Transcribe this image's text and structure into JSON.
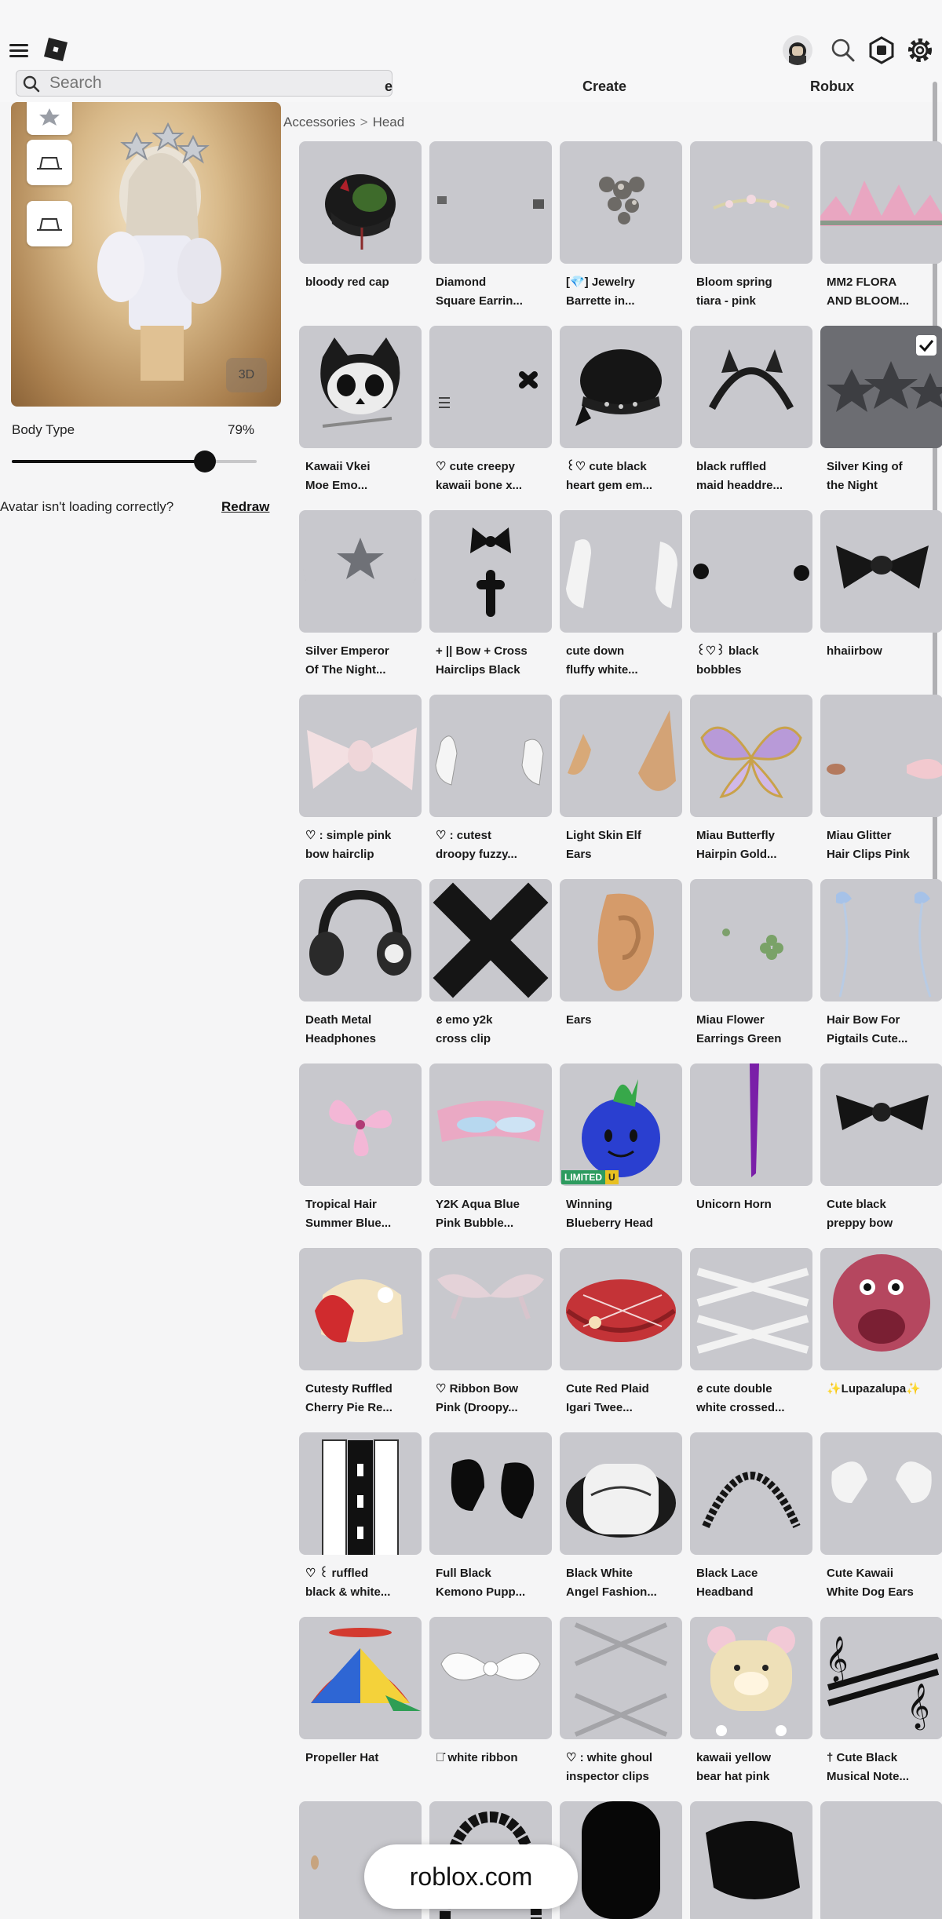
{
  "header": {
    "search_placeholder": "Search",
    "nav": [
      "e",
      "Create",
      "Robux"
    ]
  },
  "preview": {
    "btn_3d": "3D"
  },
  "body_type": {
    "label": "Body Type",
    "value_label": "79%",
    "value": 0.79
  },
  "redraw": {
    "text": "Avatar isn't loading correctly?",
    "link": "Redraw"
  },
  "breadcrumb": {
    "parent": "Accessories",
    "separator": ">",
    "current": "Head"
  },
  "items": [
    {
      "name": "bloody red cap",
      "icon": "cap-icon"
    },
    {
      "name": "Diamond\nSquare Earrin...",
      "icon": "earring-icon"
    },
    {
      "name": "[💎] Jewelry\nBarrette in...",
      "icon": "barrette-icon"
    },
    {
      "name": "Bloom spring\ntiara - pink",
      "icon": "tiara-icon"
    },
    {
      "name": "MM2 FLORA\nAND BLOOM...",
      "icon": "crown-icon"
    },
    {
      "name": "Kawaii Vkei\nMoe Emo...",
      "icon": "cat-skull-icon"
    },
    {
      "name": "♡ cute creepy\nkawaii bone x...",
      "icon": "bone-clip-icon"
    },
    {
      "name": "꒰♡ cute black\nheart gem em...",
      "icon": "black-hat-icon"
    },
    {
      "name": "black ruffled\nmaid headdre...",
      "icon": "headband-icon"
    },
    {
      "name": "Silver King of\nthe Night",
      "icon": "star-crown-icon",
      "selected": true
    },
    {
      "name": "Silver Emperor\nOf The Night...",
      "icon": "star-moon-icon"
    },
    {
      "name": "+ || Bow + Cross\nHairclips Black",
      "icon": "bow-cross-icon"
    },
    {
      "name": "cute down\nfluffy white...",
      "icon": "fluffy-ears-icon"
    },
    {
      "name": "꒰♡꒱ black\nbobbles",
      "icon": "bobbles-icon"
    },
    {
      "name": "hhaiirbow",
      "icon": "black-bow-icon"
    },
    {
      "name": "♡ : simple pink\nbow hairclip",
      "icon": "pink-bow-icon"
    },
    {
      "name": "♡ : cutest\ndroopy fuzzy...",
      "icon": "droopy-ears-icon"
    },
    {
      "name": "Light Skin Elf\nEars",
      "icon": "elf-ears-icon"
    },
    {
      "name": "Miau Butterfly\nHairpin Gold...",
      "icon": "butterfly-icon"
    },
    {
      "name": "Miau Glitter\nHair Clips Pink",
      "icon": "hair-clip-icon"
    },
    {
      "name": "Death Metal\nHeadphones",
      "icon": "headphones-icon"
    },
    {
      "name": "ꫀ emo y2k\ncross clip",
      "icon": "cross-clip-icon"
    },
    {
      "name": "Ears",
      "icon": "ear-icon"
    },
    {
      "name": "Miau Flower\nEarrings Green",
      "icon": "flower-earring-icon"
    },
    {
      "name": "Hair Bow For\nPigtails Cute...",
      "icon": "ribbon-icon"
    },
    {
      "name": "Tropical Hair\nSummer Blue...",
      "icon": "hibiscus-icon"
    },
    {
      "name": "Y2K Aqua Blue\nPink Bubble...",
      "icon": "visor-icon"
    },
    {
      "name": "Winning\nBlueberry Head",
      "icon": "blueberry-icon",
      "badge": [
        "LIMITED",
        "U"
      ]
    },
    {
      "name": "Unicorn Horn",
      "icon": "horn-icon"
    },
    {
      "name": "Cute black\npreppy bow",
      "icon": "preppy-bow-icon"
    },
    {
      "name": "Cutesty Ruffled\nCherry Pie Re...",
      "icon": "cherry-bonnet-icon"
    },
    {
      "name": "♡ Ribbon Bow\nPink (Droopy...",
      "icon": "droopy-bow-icon"
    },
    {
      "name": "Cute Red Plaid\nIgari Twee...",
      "icon": "beret-icon"
    },
    {
      "name": "ꫀ cute double\nwhite crossed...",
      "icon": "crossed-clips-icon"
    },
    {
      "name": "✨Lupazalupa✨",
      "icon": "lips-face-icon"
    },
    {
      "name": "♡ ꒰ ruffled\nblack & white...",
      "icon": "ruffle-icon"
    },
    {
      "name": "Full Black\nKemono Pupp...",
      "icon": "puppy-ears-icon"
    },
    {
      "name": "Black White\nAngel Fashion...",
      "icon": "fur-hat-icon"
    },
    {
      "name": "Black Lace\nHeadband",
      "icon": "lace-headband-icon"
    },
    {
      "name": "Cute Kawaii\nWhite Dog Ears",
      "icon": "dog-ears-icon"
    },
    {
      "name": "Propeller Hat",
      "icon": "propeller-hat-icon"
    },
    {
      "name": "๑̇ white ribbon",
      "icon": "white-ribbon-icon"
    },
    {
      "name": "♡ : white ghoul\ninspector clips",
      "icon": "ghoul-clips-icon"
    },
    {
      "name": "kawaii yellow\nbear hat pink",
      "icon": "bear-hat-icon"
    },
    {
      "name": "† Cute Black\nMusical Note...",
      "icon": "music-note-icon"
    },
    {
      "name": "",
      "icon": "small-item-icon"
    },
    {
      "name": "",
      "icon": "braid-icon"
    },
    {
      "name": "",
      "icon": "black-head-icon"
    },
    {
      "name": "",
      "icon": "black-cap-icon"
    },
    {
      "name": "",
      "icon": "empty-icon"
    }
  ],
  "domain_pill": "roblox.com"
}
